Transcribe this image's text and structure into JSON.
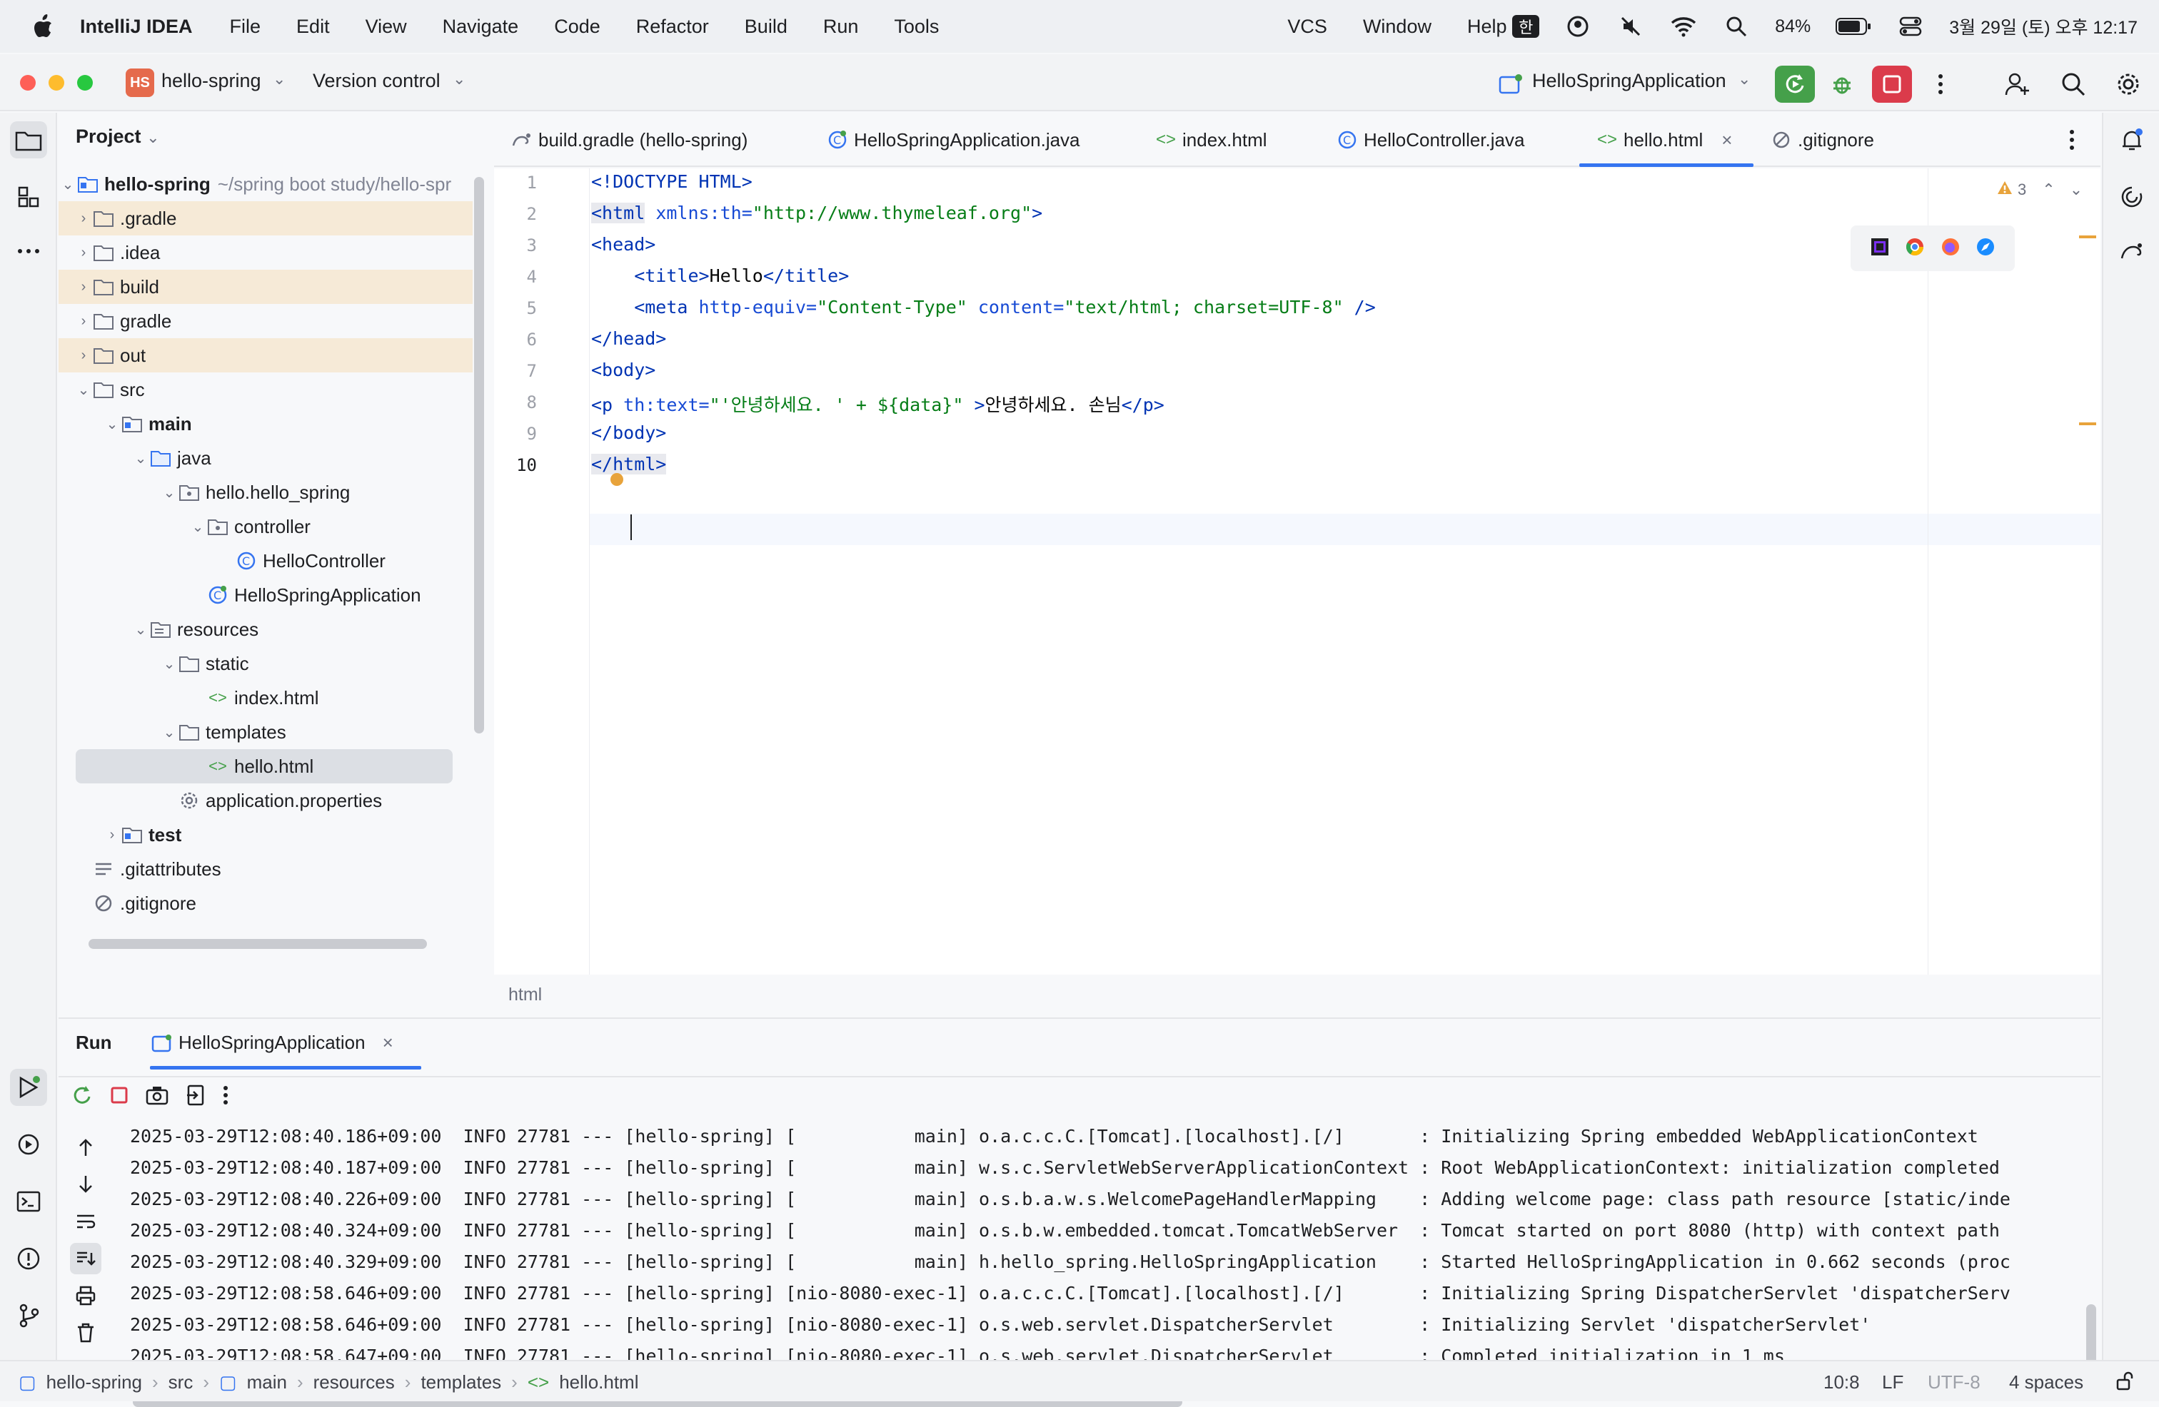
{
  "menubar": {
    "app_name": "IntelliJ IDEA",
    "items": [
      "File",
      "Edit",
      "View",
      "Navigate",
      "Code",
      "Refactor",
      "Build",
      "Run",
      "Tools"
    ],
    "right_items": [
      "VCS",
      "Window",
      "Help"
    ],
    "ime": "한",
    "battery": "84%",
    "datetime": "3월 29일 (토) 오후 12:17"
  },
  "titlebar": {
    "project_badge": "HS",
    "project_name": "hello-spring",
    "version_control": "Version control",
    "run_config": "HelloSpringApplication"
  },
  "project_panel": {
    "title": "Project",
    "root_name": "hello-spring",
    "root_path": "~/spring boot study/hello-spr",
    "items": [
      {
        "label": ".gradle"
      },
      {
        "label": ".idea"
      },
      {
        "label": "build"
      },
      {
        "label": "gradle"
      },
      {
        "label": "out"
      },
      {
        "label": "src"
      },
      {
        "label": "main"
      },
      {
        "label": "java"
      },
      {
        "label": "hello.hello_spring"
      },
      {
        "label": "controller"
      },
      {
        "label": "HelloController"
      },
      {
        "label": "HelloSpringApplication"
      },
      {
        "label": "resources"
      },
      {
        "label": "static"
      },
      {
        "label": "index.html"
      },
      {
        "label": "templates"
      },
      {
        "label": "hello.html"
      },
      {
        "label": "application.properties"
      },
      {
        "label": "test"
      },
      {
        "label": ".gitattributes"
      },
      {
        "label": ".gitignore"
      }
    ]
  },
  "tabs": [
    {
      "label": "build.gradle (hello-spring)"
    },
    {
      "label": "HelloSpringApplication.java"
    },
    {
      "label": "index.html"
    },
    {
      "label": "HelloController.java"
    },
    {
      "label": "hello.html"
    },
    {
      "label": ".gitignore"
    }
  ],
  "editor": {
    "warnings_count": "3",
    "line_numbers": [
      "1",
      "2",
      "3",
      "4",
      "5",
      "6",
      "7",
      "8",
      "9",
      "10"
    ],
    "lines": [
      {
        "p": [
          "<!DOCTYPE HTML>"
        ]
      },
      {
        "p": [
          "<html",
          " xmlns:th=",
          "\"http://www.thymeleaf.org\"",
          ">"
        ]
      },
      {
        "p": [
          "<head>"
        ]
      },
      {
        "p": [
          "    <title>",
          "Hello",
          "</title>"
        ]
      },
      {
        "p": [
          "    <meta",
          " http-equiv=",
          "\"Content-Type\"",
          " content=",
          "\"text/html; charset=UTF-8\"",
          " />"
        ]
      },
      {
        "p": [
          "</head>"
        ]
      },
      {
        "p": [
          "<body>"
        ]
      },
      {
        "p": [
          "<p",
          " th:text=",
          "\"'안녕하세요. ' + ${data}\"",
          " >",
          "안녕하세요. 손님",
          "</p>"
        ]
      },
      {
        "p": [
          "</body>"
        ]
      },
      {
        "p": [
          "</html>"
        ]
      }
    ],
    "breadcrumb": "html"
  },
  "run_panel": {
    "title": "Run",
    "tab": "HelloSpringApplication",
    "log": [
      "2025-03-29T12:08:40.186+09:00  INFO 27781 --- [hello-spring] [           main] o.a.c.c.C.[Tomcat].[localhost].[/]       : Initializing Spring embedded WebApplicationContext",
      "2025-03-29T12:08:40.187+09:00  INFO 27781 --- [hello-spring] [           main] w.s.c.ServletWebServerApplicationContext : Root WebApplicationContext: initialization completed",
      "2025-03-29T12:08:40.226+09:00  INFO 27781 --- [hello-spring] [           main] o.s.b.a.w.s.WelcomePageHandlerMapping    : Adding welcome page: class path resource [static/inde",
      "2025-03-29T12:08:40.324+09:00  INFO 27781 --- [hello-spring] [           main] o.s.b.w.embedded.tomcat.TomcatWebServer  : Tomcat started on port 8080 (http) with context path",
      "2025-03-29T12:08:40.329+09:00  INFO 27781 --- [hello-spring] [           main] h.hello_spring.HelloSpringApplication    : Started HelloSpringApplication in 0.662 seconds (proc",
      "2025-03-29T12:08:58.646+09:00  INFO 27781 --- [hello-spring] [nio-8080-exec-1] o.a.c.c.C.[Tomcat].[localhost].[/]       : Initializing Spring DispatcherServlet 'dispatcherServ",
      "2025-03-29T12:08:58.646+09:00  INFO 27781 --- [hello-spring] [nio-8080-exec-1] o.s.web.servlet.DispatcherServlet        : Initializing Servlet 'dispatcherServlet'",
      "2025-03-29T12:08:58.647+09:00  INFO 27781 --- [hello-spring] [nio-8080-exec-1] o.s.web.servlet.DispatcherServlet        : Completed initialization in 1 ms"
    ]
  },
  "statusbar": {
    "crumbs": [
      "hello-spring",
      "src",
      "main",
      "resources",
      "templates",
      "hello.html"
    ],
    "position": "10:8",
    "line_sep": "LF",
    "encoding": "UTF-8",
    "indent": "4 spaces"
  },
  "colors": {
    "accent": "#3574f0",
    "folder_highlight": "#f6ead7",
    "selection": "#dcdfe4",
    "tag": "#0033b3",
    "string": "#067d17"
  }
}
